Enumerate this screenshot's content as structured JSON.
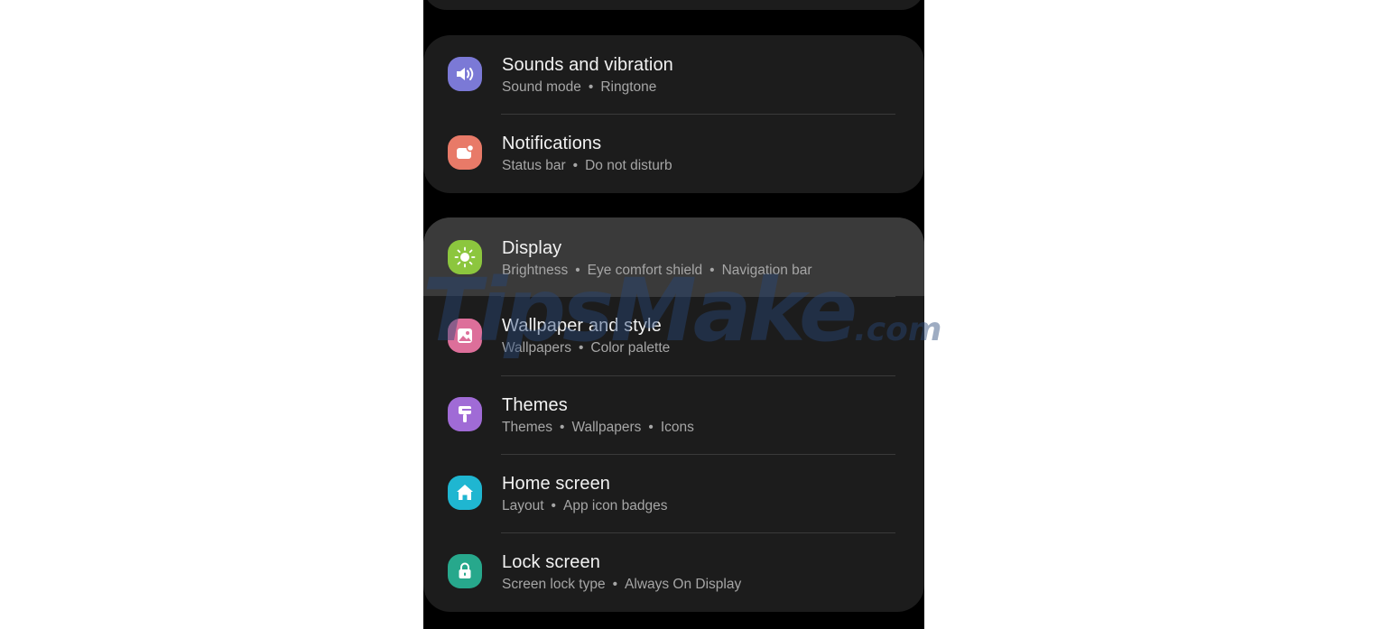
{
  "settings": {
    "groups": [
      {
        "items": [
          {
            "title": "Sounds and vibration",
            "subtitle": [
              "Sound mode",
              "Ringtone"
            ],
            "icon": "speaker-icon",
            "icon_color": "#7b79d6"
          },
          {
            "title": "Notifications",
            "subtitle": [
              "Status bar",
              "Do not disturb"
            ],
            "icon": "notification-icon",
            "icon_color": "#e87a68"
          }
        ]
      },
      {
        "items": [
          {
            "title": "Display",
            "subtitle": [
              "Brightness",
              "Eye comfort shield",
              "Navigation bar"
            ],
            "icon": "brightness-icon",
            "icon_color": "#8cc63e",
            "highlighted": true
          },
          {
            "title": "Wallpaper and style",
            "subtitle": [
              "Wallpapers",
              "Color palette"
            ],
            "icon": "wallpaper-icon",
            "icon_color": "#dd6f9a"
          },
          {
            "title": "Themes",
            "subtitle": [
              "Themes",
              "Wallpapers",
              "Icons"
            ],
            "icon": "theme-brush-icon",
            "icon_color": "#a06bd6"
          },
          {
            "title": "Home screen",
            "subtitle": [
              "Layout",
              "App icon badges"
            ],
            "icon": "home-icon",
            "icon_color": "#1fb6d1"
          },
          {
            "title": "Lock screen",
            "subtitle": [
              "Screen lock type",
              "Always On Display"
            ],
            "icon": "lock-icon",
            "icon_color": "#27a88c"
          }
        ]
      }
    ]
  },
  "watermark": {
    "main": "TipsMake",
    "suffix": ".com"
  },
  "separator_glyph": "•"
}
